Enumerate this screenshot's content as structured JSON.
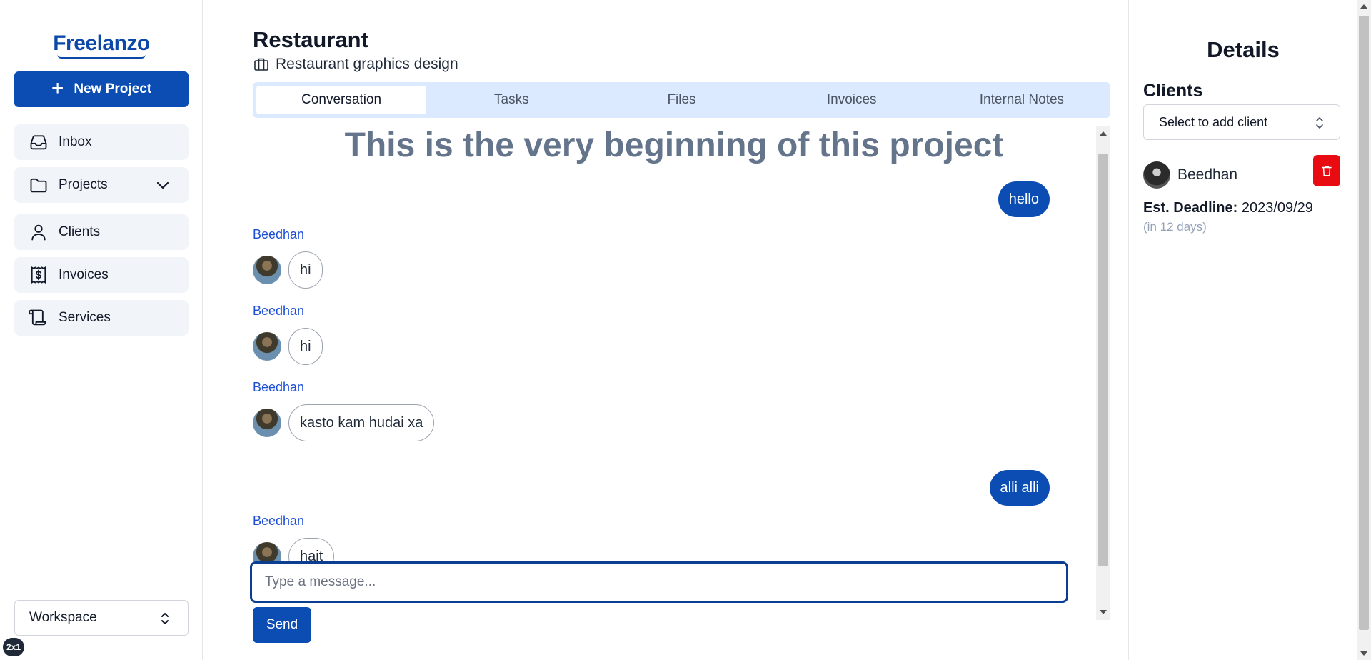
{
  "brand": {
    "name": "Freelanzo",
    "color": "#0b48a8"
  },
  "sidebar": {
    "new_project_label": "New Project",
    "items": [
      {
        "label": "Inbox",
        "icon": "inbox-icon"
      },
      {
        "label": "Projects",
        "icon": "folder-icon",
        "expandable": true
      },
      {
        "label": "Clients",
        "icon": "user-icon"
      },
      {
        "label": "Invoices",
        "icon": "invoice-dollar-icon"
      },
      {
        "label": "Services",
        "icon": "scroll-icon"
      }
    ],
    "workspace_label": "Workspace",
    "badge": "2x1"
  },
  "project": {
    "title": "Restaurant",
    "subtitle": "Restaurant graphics design"
  },
  "tabs": [
    {
      "label": "Conversation",
      "active": true
    },
    {
      "label": "Tasks",
      "active": false
    },
    {
      "label": "Files",
      "active": false
    },
    {
      "label": "Invoices",
      "active": false
    },
    {
      "label": "Internal Notes",
      "active": false
    }
  ],
  "conversation": {
    "beginning_text": "This is the very beginning of this project",
    "messages": [
      {
        "direction": "out",
        "text": "hello"
      },
      {
        "direction": "in",
        "sender": "Beedhan",
        "text": "hi"
      },
      {
        "direction": "in",
        "sender": "Beedhan",
        "text": "hi"
      },
      {
        "direction": "in",
        "sender": "Beedhan",
        "text": "kasto kam hudai xa"
      },
      {
        "direction": "out",
        "text": "alli alli"
      },
      {
        "direction": "in",
        "sender": "Beedhan",
        "text": "hait"
      }
    ],
    "input_placeholder": "Type a message...",
    "send_label": "Send"
  },
  "details": {
    "title": "Details",
    "clients_heading": "Clients",
    "client_select_placeholder": "Select to add client",
    "clients": [
      {
        "name": "Beedhan"
      }
    ],
    "deadline_label": "Est. Deadline:",
    "deadline_value": "2023/09/29",
    "deadline_relative": "(in 12 days)"
  },
  "colors": {
    "primary": "#0b4db3",
    "danger": "#e80b12",
    "tab_bar_bg": "#dbeafe",
    "nav_item_bg": "#f1f4f8"
  }
}
